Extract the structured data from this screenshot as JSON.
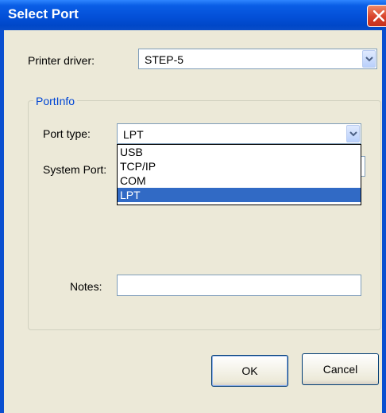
{
  "window": {
    "title": "Select Port",
    "close_label": "Close"
  },
  "printer_driver": {
    "label": "Printer driver:",
    "value": "STEP-5"
  },
  "port_info": {
    "title": "PortInfo",
    "port_type": {
      "label": "Port type:",
      "value": "LPT",
      "options": [
        "USB",
        "TCP/IP",
        "COM",
        "LPT"
      ],
      "highlighted": "LPT"
    },
    "system_port": {
      "label": "System Port:"
    },
    "notes": {
      "label": "Notes:",
      "value": ""
    }
  },
  "buttons": {
    "ok": "OK",
    "cancel": "Cancel"
  },
  "colors": {
    "title_bar": "#0350d8",
    "selection": "#316ac5",
    "group_title": "#0046d5",
    "client": "#ece9d8"
  }
}
